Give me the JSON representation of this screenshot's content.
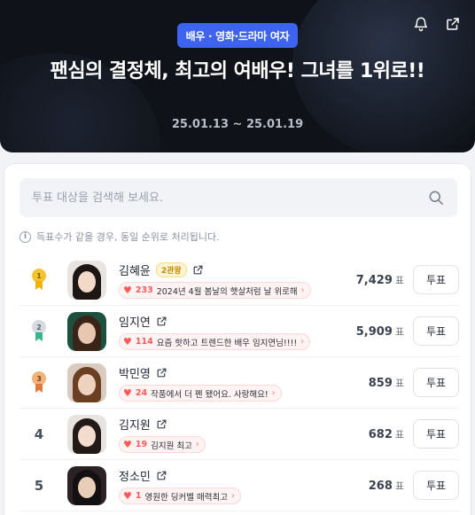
{
  "header": {
    "category": "배우 · 영화·드라마 여자",
    "title": "팬심의 결정체, 최고의 여배우! 그녀를 1위로!!",
    "period": "25.01.13 ~ 25.01.19",
    "icons": [
      "bell-icon",
      "share-icon"
    ]
  },
  "search": {
    "placeholder": "투표 대상을 검색해 보세요."
  },
  "notice": "득표수가 같을 경우, 동일 순위로 처리됩니다.",
  "vote_unit": "표",
  "vote_button_label": "투표",
  "rankings": [
    {
      "rank": "1",
      "name": "김혜윤",
      "tag": "2관왕",
      "cheer_count": "233",
      "cheer_text": "2024년 4월 봄날의 햇살처럼 날 위로해",
      "votes": "7,429",
      "medal": "gold"
    },
    {
      "rank": "2",
      "name": "임지연",
      "tag": "",
      "cheer_count": "114",
      "cheer_text": "요즘 핫하고 트렌드한 배우 임지연님!!!!",
      "votes": "5,909",
      "medal": "silver"
    },
    {
      "rank": "3",
      "name": "박민영",
      "tag": "",
      "cheer_count": "24",
      "cheer_text": "작품에서 더 펜 됐어요. 사랑해요!",
      "votes": "859",
      "medal": "bronze"
    },
    {
      "rank": "4",
      "name": "김지원",
      "tag": "",
      "cheer_count": "19",
      "cheer_text": "김지원 최고",
      "votes": "682",
      "medal": ""
    },
    {
      "rank": "5",
      "name": "정소민",
      "tag": "",
      "cheer_count": "1",
      "cheer_text": "영원한 딩커벨 매력최고",
      "votes": "268",
      "medal": ""
    }
  ],
  "colors": {
    "accent": "#3d63f0",
    "hero_bg": "#0f1218",
    "gold": "#f4c430",
    "silver": "#c5cad3",
    "bronze": "#f0a060",
    "heart": "#ff5a5a"
  }
}
